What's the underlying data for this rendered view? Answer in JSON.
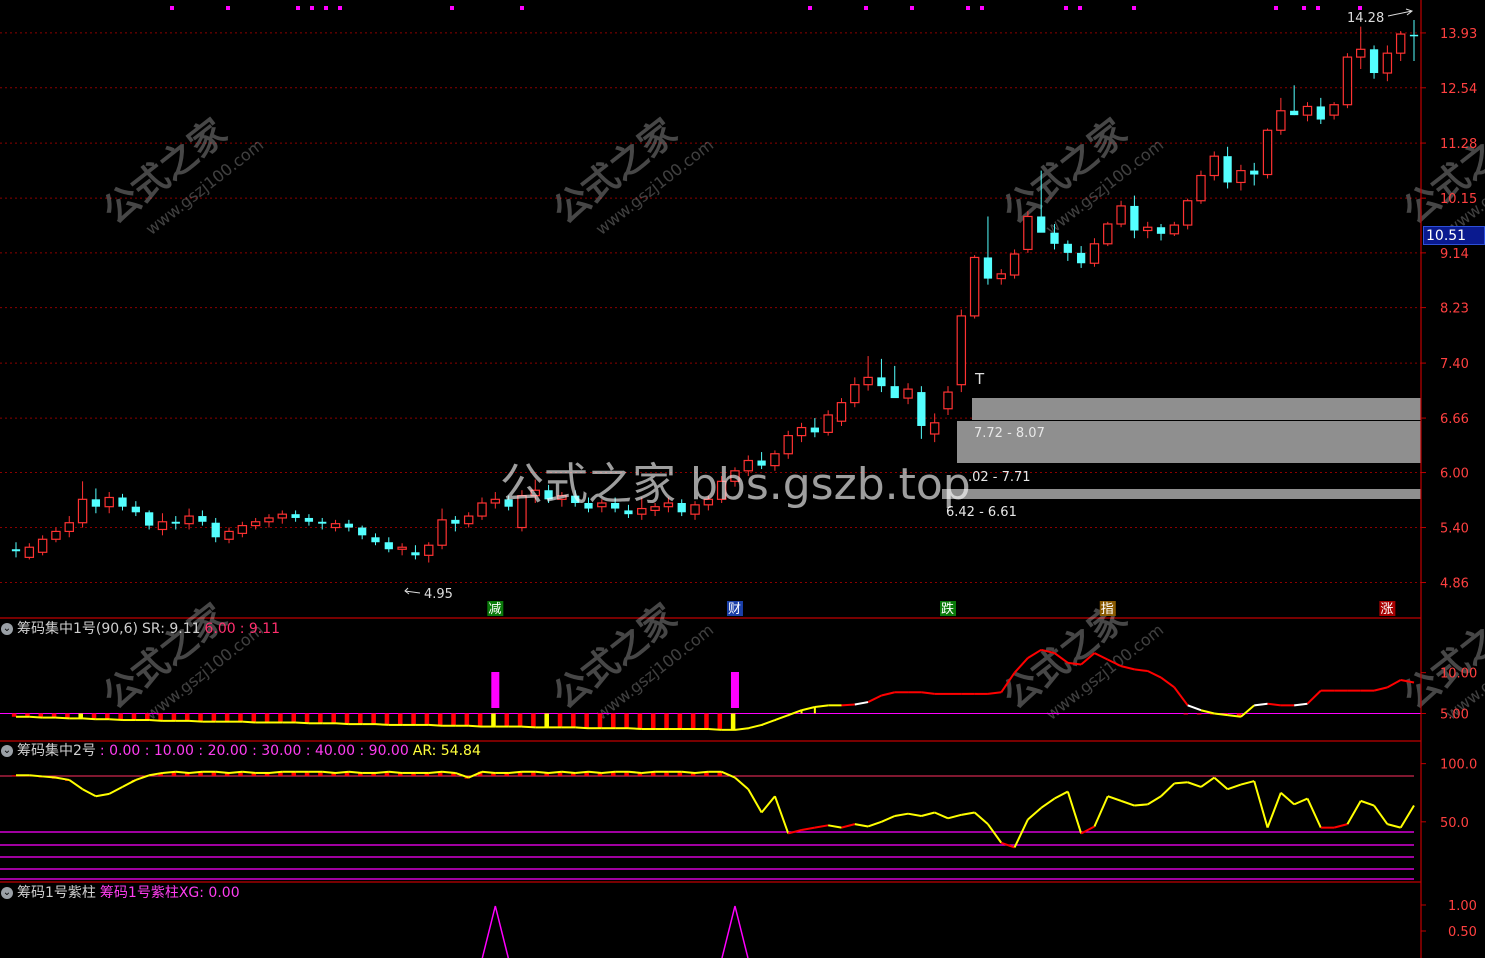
{
  "colors": {
    "bg": "#000000",
    "up": "#ff3232",
    "down": "#54ffff",
    "grid": "#8b0000",
    "axis_line": "#c00000",
    "axis_text": "#ff4040",
    "purple": "#ff00ff",
    "yellow": "#ffff00",
    "red_line": "#ff0000",
    "gray_zone": "#8c8c8c"
  },
  "main_panel": {
    "price_label": "10.51",
    "high_marker": "14.28",
    "low_marker": "4.95",
    "t_marker": "T",
    "zones": [
      {
        "label": "7.72 - 8.07",
        "lo": 7.72,
        "hi": 8.07
      },
      {
        "label": ".02 - 7.71",
        "lo": 7.02,
        "hi": 7.71
      },
      {
        "label": "6.42 - 6.61",
        "lo": 6.42,
        "hi": 6.61
      }
    ],
    "event_tags": [
      {
        "text": "减",
        "bar": 36,
        "color": "#0a7a0a"
      },
      {
        "text": "财",
        "bar": 54,
        "color": "#1a3fa8"
      },
      {
        "text": "跌",
        "bar": 70,
        "color": "#0a7a0a"
      },
      {
        "text": "指",
        "bar": 82,
        "color": "#8a5a00"
      },
      {
        "text": "涨",
        "bar": 103,
        "color": "#a80000"
      }
    ]
  },
  "watermark": {
    "big": "公式之家 bbs.gszb.top",
    "small_cn": "公式之家",
    "small_url": "www.gszj100.com"
  },
  "panel1": {
    "name": "筹码集中1号(90,6)",
    "sr_label": "SR: 9.11",
    "v1": "6.00",
    "v2": ": 9.11"
  },
  "panel2": {
    "name": "筹码集中2号",
    "levels": ": 0.00 : 10.00 : 20.00 : 30.00 : 40.00 : 90.00",
    "ar_label": "AR: 54.84"
  },
  "panel3": {
    "name": "筹码1号紫柱",
    "sub": "筹码1号紫柱XG: 0.00"
  },
  "chart_data": [
    {
      "type": "candlestick",
      "title": "",
      "y_ticks": [
        13.93,
        12.54,
        11.28,
        10.15,
        9.14,
        8.23,
        7.4,
        6.66,
        6.0,
        5.4,
        4.86
      ],
      "ylim": [
        4.7,
        14.5
      ],
      "log_scale": true,
      "ohlc": [
        [
          5.18,
          5.25,
          5.1,
          5.16
        ],
        [
          5.1,
          5.24,
          5.08,
          5.2
        ],
        [
          5.15,
          5.32,
          5.12,
          5.28
        ],
        [
          5.28,
          5.4,
          5.25,
          5.36
        ],
        [
          5.36,
          5.52,
          5.3,
          5.45
        ],
        [
          5.45,
          5.9,
          5.4,
          5.7
        ],
        [
          5.7,
          5.82,
          5.55,
          5.62
        ],
        [
          5.62,
          5.78,
          5.55,
          5.72
        ],
        [
          5.72,
          5.76,
          5.58,
          5.62
        ],
        [
          5.62,
          5.68,
          5.52,
          5.56
        ],
        [
          5.56,
          5.58,
          5.38,
          5.42
        ],
        [
          5.38,
          5.55,
          5.32,
          5.46
        ],
        [
          5.46,
          5.52,
          5.38,
          5.44
        ],
        [
          5.44,
          5.6,
          5.38,
          5.52
        ],
        [
          5.52,
          5.58,
          5.42,
          5.46
        ],
        [
          5.45,
          5.5,
          5.25,
          5.3
        ],
        [
          5.28,
          5.4,
          5.24,
          5.36
        ],
        [
          5.34,
          5.46,
          5.3,
          5.42
        ],
        [
          5.42,
          5.5,
          5.38,
          5.46
        ],
        [
          5.46,
          5.54,
          5.4,
          5.5
        ],
        [
          5.5,
          5.58,
          5.44,
          5.54
        ],
        [
          5.54,
          5.58,
          5.46,
          5.5
        ],
        [
          5.5,
          5.54,
          5.42,
          5.46
        ],
        [
          5.46,
          5.5,
          5.38,
          5.44
        ],
        [
          5.4,
          5.48,
          5.36,
          5.44
        ],
        [
          5.44,
          5.48,
          5.36,
          5.4
        ],
        [
          5.4,
          5.42,
          5.28,
          5.32
        ],
        [
          5.3,
          5.34,
          5.22,
          5.25
        ],
        [
          5.25,
          5.3,
          5.15,
          5.18
        ],
        [
          5.18,
          5.24,
          5.12,
          5.2
        ],
        [
          5.15,
          5.22,
          5.08,
          5.12
        ],
        [
          5.12,
          5.25,
          5.05,
          5.22
        ],
        [
          5.22,
          5.6,
          5.18,
          5.48
        ],
        [
          5.48,
          5.52,
          5.36,
          5.44
        ],
        [
          5.44,
          5.56,
          5.4,
          5.52
        ],
        [
          5.52,
          5.72,
          5.48,
          5.66
        ],
        [
          5.66,
          5.78,
          5.6,
          5.7
        ],
        [
          5.7,
          5.74,
          5.58,
          5.62
        ],
        [
          5.4,
          5.8,
          5.36,
          5.74
        ],
        [
          5.74,
          5.92,
          5.66,
          5.8
        ],
        [
          5.8,
          5.86,
          5.66,
          5.7
        ],
        [
          5.7,
          5.78,
          5.62,
          5.74
        ],
        [
          5.74,
          5.8,
          5.62,
          5.66
        ],
        [
          5.66,
          5.72,
          5.56,
          5.6
        ],
        [
          5.62,
          5.7,
          5.56,
          5.66
        ],
        [
          5.66,
          5.72,
          5.56,
          5.6
        ],
        [
          5.58,
          5.64,
          5.5,
          5.54
        ],
        [
          5.54,
          5.72,
          5.48,
          5.6
        ],
        [
          5.58,
          5.66,
          5.52,
          5.62
        ],
        [
          5.62,
          5.72,
          5.56,
          5.66
        ],
        [
          5.66,
          5.7,
          5.52,
          5.56
        ],
        [
          5.54,
          5.68,
          5.48,
          5.64
        ],
        [
          5.64,
          5.74,
          5.58,
          5.7
        ],
        [
          5.7,
          5.96,
          5.66,
          5.9
        ],
        [
          5.9,
          6.06,
          5.84,
          6.02
        ],
        [
          6.02,
          6.2,
          5.96,
          6.14
        ],
        [
          6.14,
          6.24,
          6.04,
          6.08
        ],
        [
          6.08,
          6.26,
          6.02,
          6.22
        ],
        [
          6.22,
          6.5,
          6.16,
          6.44
        ],
        [
          6.44,
          6.6,
          6.36,
          6.54
        ],
        [
          6.54,
          6.66,
          6.42,
          6.48
        ],
        [
          6.48,
          6.76,
          6.44,
          6.7
        ],
        [
          6.62,
          6.92,
          6.56,
          6.86
        ],
        [
          6.86,
          7.2,
          6.8,
          7.1
        ],
        [
          7.1,
          7.5,
          7.02,
          7.2
        ],
        [
          7.2,
          7.46,
          7.0,
          7.08
        ],
        [
          7.08,
          7.36,
          6.98,
          6.92
        ],
        [
          6.92,
          7.12,
          6.84,
          7.04
        ],
        [
          7.0,
          7.08,
          6.4,
          6.56
        ],
        [
          6.46,
          6.72,
          6.36,
          6.6
        ],
        [
          6.78,
          7.08,
          6.7,
          7.0
        ],
        [
          7.1,
          8.2,
          7.0,
          8.1
        ],
        [
          8.1,
          9.1,
          8.06,
          9.06
        ],
        [
          9.06,
          9.8,
          8.6,
          8.7
        ],
        [
          8.7,
          8.86,
          8.6,
          8.78
        ],
        [
          8.76,
          9.2,
          8.7,
          9.12
        ],
        [
          9.2,
          9.9,
          9.14,
          9.8
        ],
        [
          9.8,
          10.7,
          9.6,
          9.5
        ],
        [
          9.5,
          9.66,
          9.2,
          9.3
        ],
        [
          9.3,
          9.36,
          9.0,
          9.14
        ],
        [
          9.14,
          9.26,
          8.88,
          8.96
        ],
        [
          8.96,
          9.4,
          8.9,
          9.3
        ],
        [
          9.3,
          9.7,
          9.26,
          9.66
        ],
        [
          9.66,
          10.1,
          9.6,
          10.0
        ],
        [
          10.0,
          10.2,
          9.4,
          9.54
        ],
        [
          9.54,
          9.7,
          9.4,
          9.6
        ],
        [
          9.6,
          9.66,
          9.36,
          9.48
        ],
        [
          9.48,
          9.7,
          9.44,
          9.64
        ],
        [
          9.64,
          10.14,
          9.56,
          10.1
        ],
        [
          10.1,
          10.7,
          10.04,
          10.6
        ],
        [
          10.6,
          11.1,
          10.5,
          11.0
        ],
        [
          11.0,
          11.2,
          10.34,
          10.46
        ],
        [
          10.46,
          10.82,
          10.3,
          10.7
        ],
        [
          10.7,
          10.86,
          10.4,
          10.62
        ],
        [
          10.62,
          11.6,
          10.54,
          11.56
        ],
        [
          11.56,
          12.3,
          11.46,
          12.0
        ],
        [
          12.0,
          12.6,
          11.9,
          11.9
        ],
        [
          11.9,
          12.2,
          11.76,
          12.1
        ],
        [
          12.1,
          12.3,
          11.7,
          11.8
        ],
        [
          11.9,
          12.2,
          11.8,
          12.14
        ],
        [
          12.14,
          13.4,
          12.06,
          13.3
        ],
        [
          13.3,
          14.1,
          13.0,
          13.5
        ],
        [
          13.5,
          13.6,
          12.76,
          12.9
        ],
        [
          12.9,
          13.6,
          12.7,
          13.4
        ],
        [
          13.4,
          13.98,
          13.2,
          13.9
        ],
        [
          13.88,
          14.28,
          13.2,
          13.86
        ]
      ]
    },
    {
      "type": "bar_line",
      "title": "筹码集中1号(90,6)",
      "y_ticks": [
        10.0,
        5.0
      ],
      "sr": [
        4.6,
        4.6,
        4.5,
        4.5,
        4.4,
        4.4,
        4.3,
        4.3,
        4.2,
        4.2,
        4.2,
        4.1,
        4.1,
        4.1,
        4.0,
        4.0,
        4.0,
        4.0,
        3.9,
        3.9,
        3.9,
        3.9,
        3.8,
        3.8,
        3.8,
        3.7,
        3.7,
        3.7,
        3.6,
        3.6,
        3.6,
        3.6,
        3.5,
        3.5,
        3.5,
        3.4,
        3.4,
        3.4,
        3.4,
        3.3,
        3.3,
        3.3,
        3.3,
        3.2,
        3.2,
        3.2,
        3.2,
        3.1,
        3.1,
        3.1,
        3.1,
        3.1,
        3.1,
        3.0,
        3.0,
        3.2,
        3.6,
        4.2,
        4.8,
        5.4,
        5.8,
        6.0,
        6.0,
        6.1,
        6.4,
        7.2,
        7.6,
        7.6,
        7.6,
        7.4,
        7.4,
        7.4,
        7.4,
        7.4,
        7.6,
        10.0,
        11.8,
        12.8,
        12.4,
        11.2,
        11.0,
        12.4,
        11.6,
        10.8,
        10.4,
        10.2,
        9.4,
        8.2,
        6.0,
        5.4,
        5.0,
        4.8,
        4.6,
        6.0,
        6.2,
        6.0,
        6.0,
        6.2,
        7.8,
        7.8,
        7.8,
        7.8,
        7.8,
        8.2,
        9.1,
        8.8,
        8.8,
        8.7
      ]
    },
    {
      "type": "line",
      "title": "筹码集中2号",
      "y_ticks": [
        100.0,
        50.0
      ],
      "ar": [
        90,
        90,
        89,
        88,
        86,
        78,
        72,
        74,
        80,
        86,
        90,
        92,
        93,
        92,
        93,
        93,
        92,
        93,
        92,
        92,
        93,
        93,
        93,
        93,
        92,
        93,
        92,
        92,
        93,
        92,
        92,
        92,
        93,
        92,
        88,
        93,
        92,
        92,
        93,
        93,
        92,
        93,
        92,
        93,
        92,
        93,
        93,
        92,
        93,
        93,
        93,
        92,
        93,
        93,
        88,
        78,
        58,
        72,
        40,
        43,
        45,
        47,
        45,
        48,
        46,
        50,
        55,
        57,
        55,
        58,
        53,
        56,
        58,
        48,
        32,
        28,
        52,
        62,
        70,
        76,
        40,
        46,
        72,
        68,
        64,
        65,
        72,
        83,
        84,
        80,
        88,
        78,
        82,
        85,
        45,
        75,
        65,
        70,
        45,
        45,
        48,
        68,
        64,
        48,
        45,
        64,
        60,
        55,
        58
      ]
    },
    {
      "type": "spike",
      "title": "筹码1号紫柱",
      "y_ticks": [
        1.0,
        0.5
      ],
      "xg_spike_bars": [
        36,
        54
      ]
    }
  ]
}
